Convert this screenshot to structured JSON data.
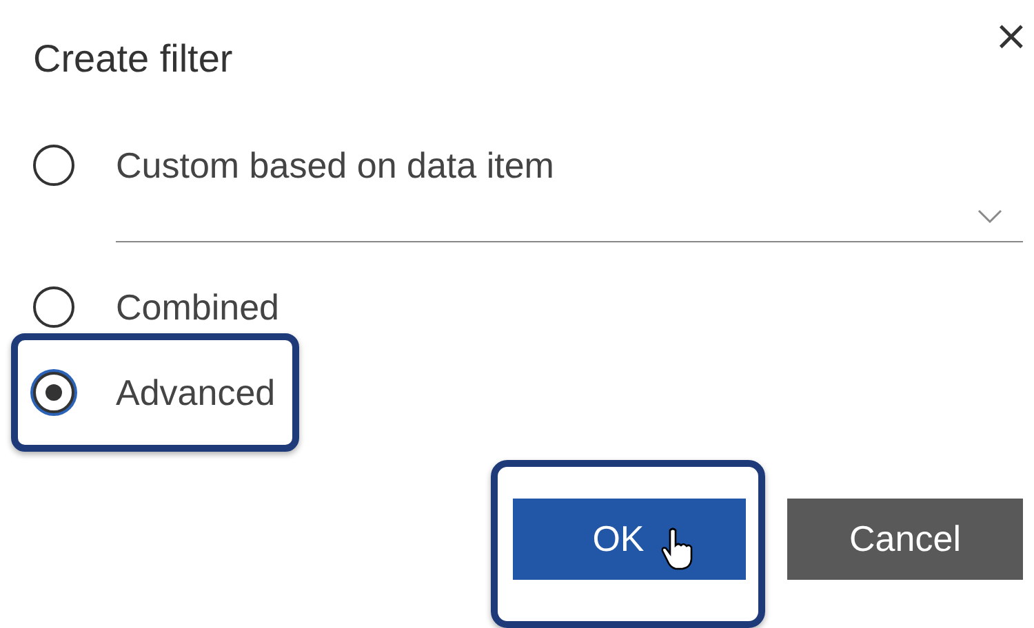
{
  "dialog": {
    "title": "Create filter",
    "close": "×"
  },
  "options": [
    {
      "label": "Custom based on data item",
      "selected": false,
      "highlighted": false,
      "has_dropdown": true
    },
    {
      "label": "Combined",
      "selected": false,
      "highlighted": false,
      "has_dropdown": false
    },
    {
      "label": "Advanced",
      "selected": true,
      "highlighted": true,
      "has_dropdown": false
    }
  ],
  "buttons": [
    {
      "label": "OK",
      "kind": "primary",
      "highlighted": true,
      "hovered": true
    },
    {
      "label": "Cancel",
      "kind": "secondary",
      "highlighted": false,
      "hovered": false
    }
  ]
}
